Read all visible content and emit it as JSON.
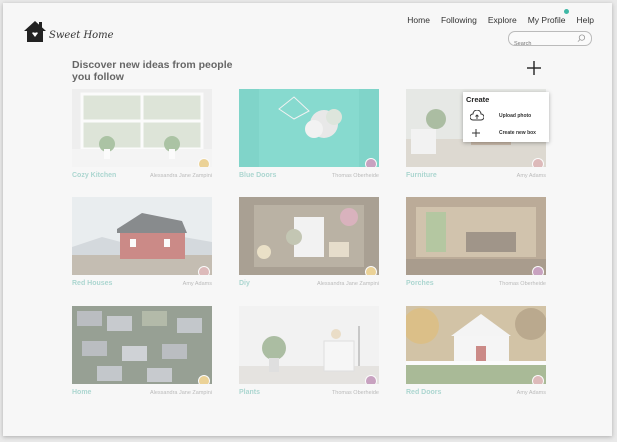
{
  "brand": {
    "name": "Sweet Home"
  },
  "nav": {
    "items": [
      "Home",
      "Following",
      "Explore",
      "My Profile",
      "Help"
    ]
  },
  "search": {
    "placeholder": "Search"
  },
  "heading": "Discover new ideas from people you follow",
  "create_menu": {
    "title": "Create",
    "items": [
      {
        "label": "Upload photo",
        "icon": "cloud-upload-icon"
      },
      {
        "label": "Create new box",
        "icon": "plus-icon"
      }
    ]
  },
  "cards": [
    {
      "title": "Cozy Kitchen",
      "author": "Alessandra Jane Zampini"
    },
    {
      "title": "Blue Doors",
      "author": "Thomas Oberheide"
    },
    {
      "title": "Furniture",
      "author": "Amy Adams"
    },
    {
      "title": "Red Houses",
      "author": "Amy Adams"
    },
    {
      "title": "Diy",
      "author": "Alessandra Jane Zampini"
    },
    {
      "title": "Porches",
      "author": "Thomas Oberheide"
    },
    {
      "title": "Home",
      "author": "Alessandra Jane Zampini"
    },
    {
      "title": "Plants",
      "author": "Thomas Oberheide"
    },
    {
      "title": "Red Doors",
      "author": "Amy Adams"
    }
  ],
  "colors": {
    "accent": "#6fbcb1",
    "notification": "#3fb8a6"
  }
}
